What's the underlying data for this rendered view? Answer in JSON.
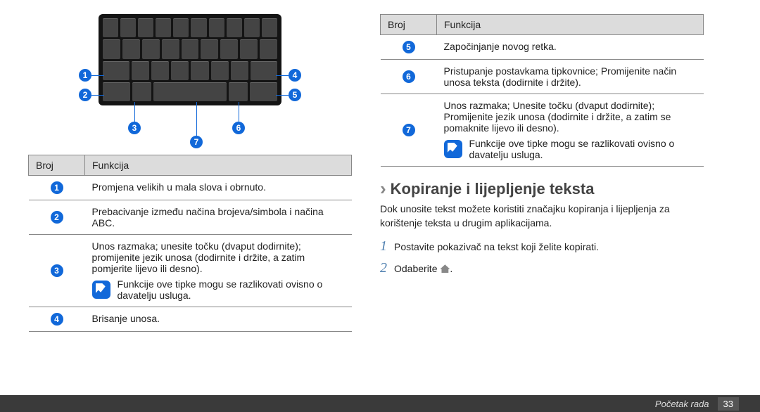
{
  "table_headers": {
    "col1": "Broj",
    "col2": "Funkcija"
  },
  "left_rows": [
    {
      "num": "1",
      "text": "Promjena velikih u mala slova i obrnuto."
    },
    {
      "num": "2",
      "text": "Prebacivanje između načina brojeva/simbola i načina ABC."
    },
    {
      "num": "3",
      "text": "Unos razmaka; unesite točku (dvaput dodirnite); promijenite jezik unosa (dodirnite i držite, a zatim pomjerite lijevo ili desno).",
      "note": "Funkcije ove tipke mogu se razlikovati ovisno o davatelju usluga."
    },
    {
      "num": "4",
      "text": "Brisanje unosa."
    }
  ],
  "right_rows": [
    {
      "num": "5",
      "text": "Započinjanje novog retka."
    },
    {
      "num": "6",
      "text": "Pristupanje postavkama tipkovnice; Promijenite način unosa teksta (dodirnite i držite)."
    },
    {
      "num": "7",
      "text": "Unos razmaka; Unesite točku (dvaput dodirnite); Promijenite jezik unosa (dodirnite i držite, a zatim se pomaknite lijevo ili desno).",
      "note": "Funkcije ove tipke mogu se razlikovati ovisno o davatelju usluga."
    }
  ],
  "section": {
    "heading": "Kopiranje i lijepljenje teksta",
    "para": "Dok unosite tekst možete koristiti značajku kopiranja i lijepljenja za korištenje teksta u drugim aplikacijama.",
    "step1_num": "1",
    "step1": "Postavite pokazivač na tekst koji želite kopirati.",
    "step2_num": "2",
    "step2": "Odaberite ",
    "step2_suffix": "."
  },
  "footer": {
    "chapter": "Početak rada",
    "page": "33"
  },
  "anno_nums": {
    "a1": "1",
    "a2": "2",
    "a3": "3",
    "a4": "4",
    "a5": "5",
    "a6": "6",
    "a7": "7"
  }
}
